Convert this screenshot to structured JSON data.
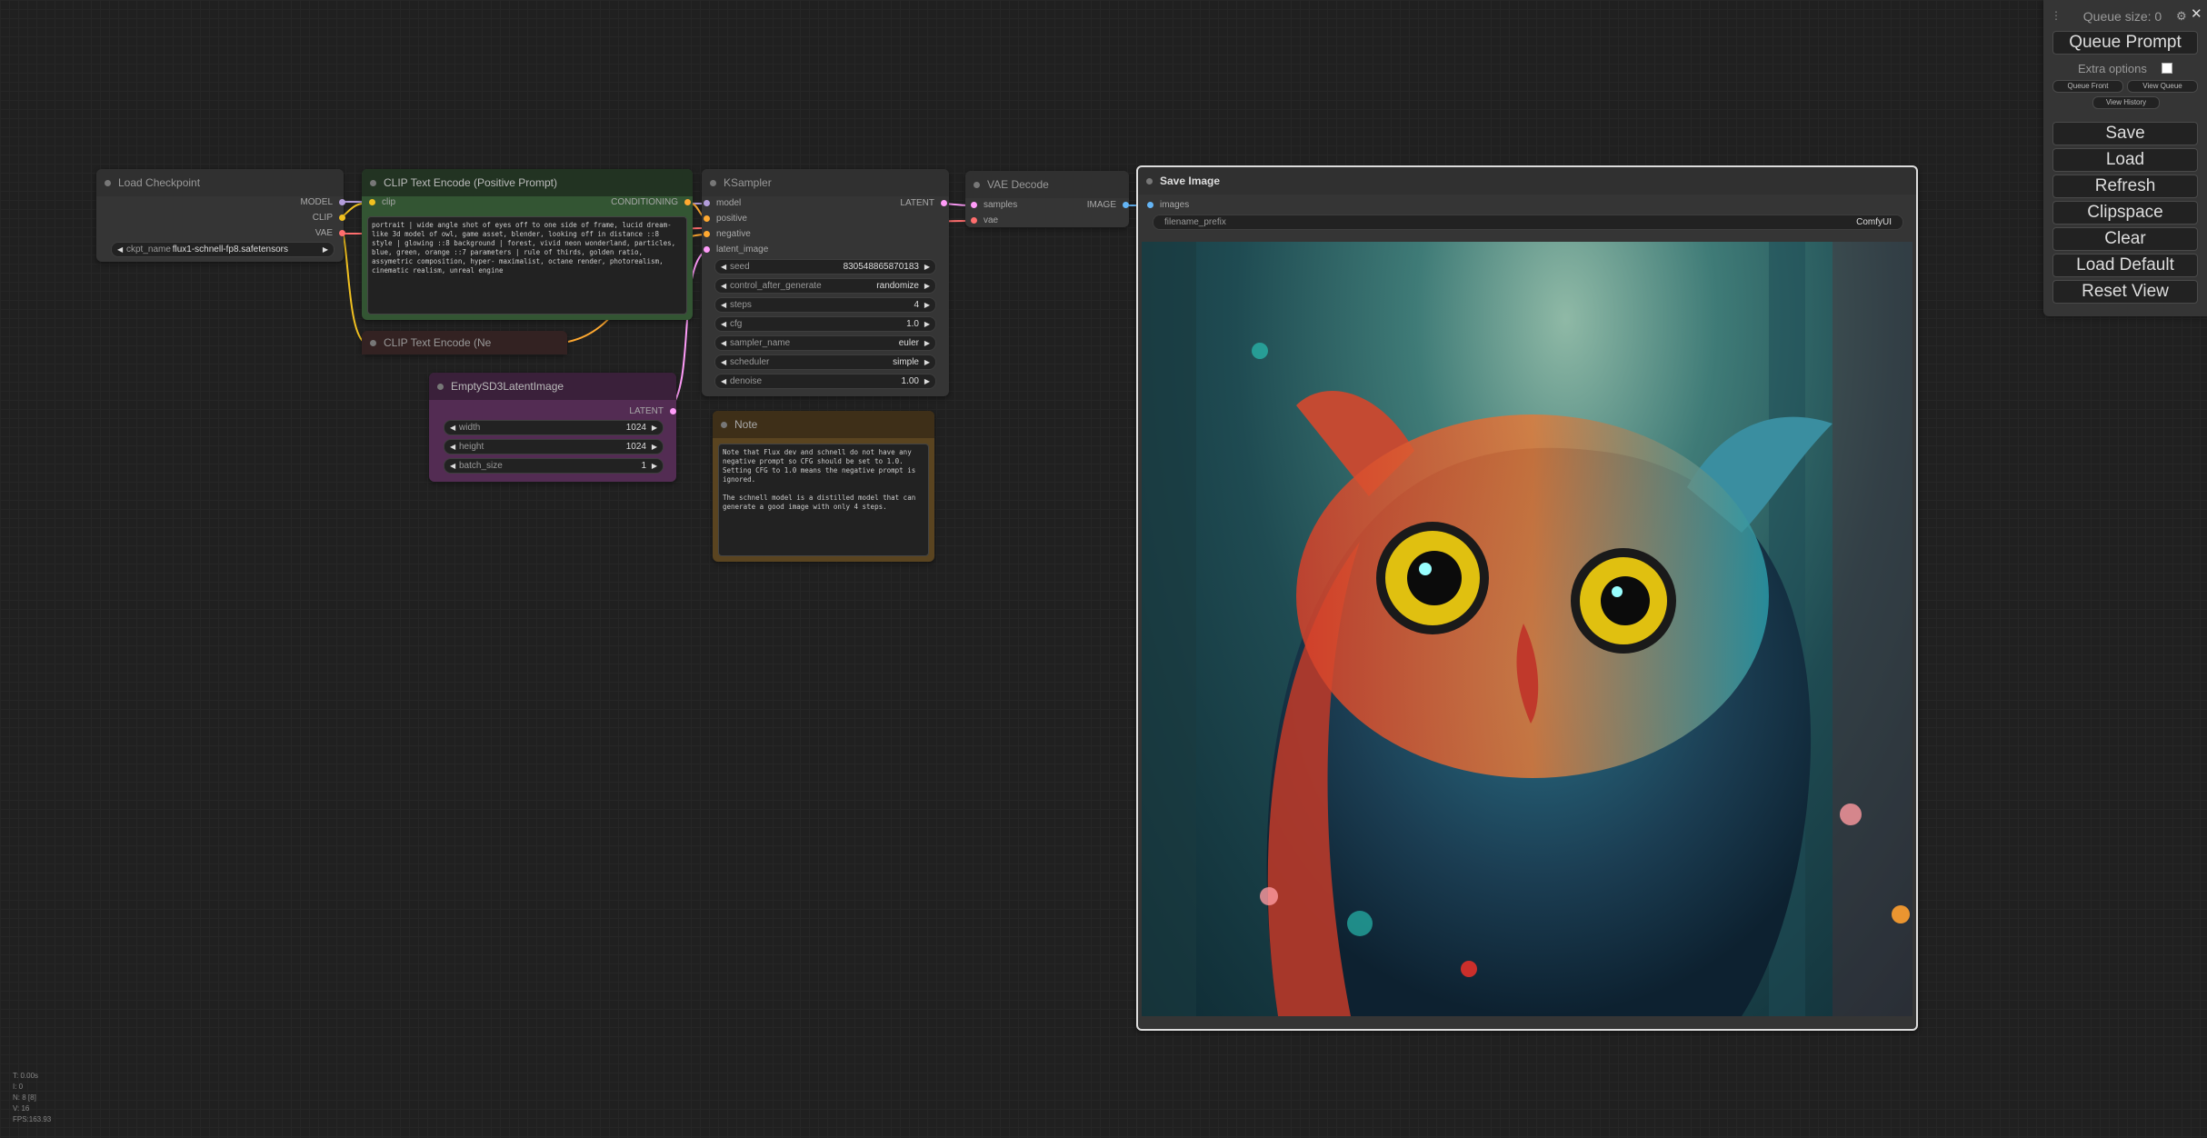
{
  "menu": {
    "queue_size": "Queue size: 0",
    "queue_prompt": "Queue Prompt",
    "extra_options": "Extra options",
    "queue_front": "Queue Front",
    "view_queue": "View Queue",
    "view_history": "View History",
    "save": "Save",
    "load": "Load",
    "refresh": "Refresh",
    "clipspace": "Clipspace",
    "clear": "Clear",
    "load_default": "Load Default",
    "reset_view": "Reset View"
  },
  "nodes": {
    "load_checkpoint": {
      "title": "Load Checkpoint",
      "out_model": "MODEL",
      "out_clip": "CLIP",
      "out_vae": "VAE",
      "ckpt_label": "ckpt_name",
      "ckpt_value": "flux1-schnell-fp8.safetensors"
    },
    "clip_pos": {
      "title": "CLIP Text Encode (Positive Prompt)",
      "in_clip": "clip",
      "out": "CONDITIONING",
      "text": "portrait | wide angle shot of eyes off to one side of frame, lucid dream-like 3d model of owl, game asset, blender, looking off in distance ::8 style | glowing ::8 background | forest, vivid neon wonderland, particles, blue, green, orange ::7 parameters | rule of thirds, golden ratio, assymetric composition, hyper- maximalist, octane render, photorealism, cinematic realism, unreal engine"
    },
    "clip_neg": {
      "title": "CLIP Text Encode (Ne"
    },
    "empty_latent": {
      "title": "EmptySD3LatentImage",
      "out": "LATENT",
      "width_label": "width",
      "width_value": "1024",
      "height_label": "height",
      "height_value": "1024",
      "batch_label": "batch_size",
      "batch_value": "1"
    },
    "ksampler": {
      "title": "KSampler",
      "in_model": "model",
      "in_positive": "positive",
      "in_negative": "negative",
      "in_latent": "latent_image",
      "out": "LATENT",
      "seed_label": "seed",
      "seed_value": "830548865870183",
      "cag_label": "control_after_generate",
      "cag_value": "randomize",
      "steps_label": "steps",
      "steps_value": "4",
      "cfg_label": "cfg",
      "cfg_value": "1.0",
      "sampler_label": "sampler_name",
      "sampler_value": "euler",
      "scheduler_label": "scheduler",
      "scheduler_value": "simple",
      "denoise_label": "denoise",
      "denoise_value": "1.00"
    },
    "note": {
      "title": "Note",
      "text": "Note that Flux dev and schnell do not have any negative prompt so CFG should be set to 1.0. Setting CFG to 1.0 means the negative prompt is ignored.\n\nThe schnell model is a distilled model that can generate a good image with only 4 steps."
    },
    "vae_decode": {
      "title": "VAE Decode",
      "in_samples": "samples",
      "in_vae": "vae",
      "out": "IMAGE"
    },
    "save_image": {
      "title": "Save Image",
      "in_images": "images",
      "prefix_label": "filename_prefix",
      "prefix_value": "ComfyUI"
    }
  },
  "stats": {
    "t": "T: 0.00s",
    "i": "I: 0",
    "n": "N: 8 [8]",
    "v": "V: 16",
    "fps": "FPS:163.93"
  }
}
